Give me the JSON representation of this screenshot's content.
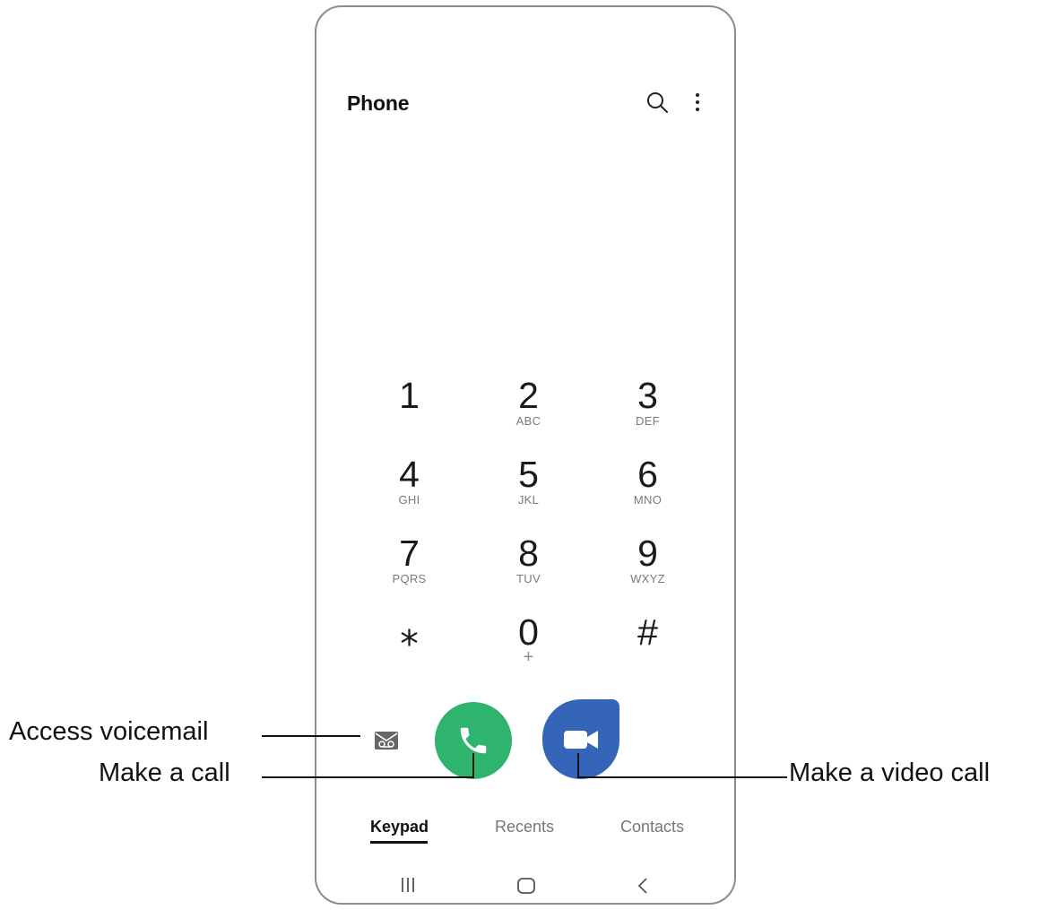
{
  "app": {
    "title": "Phone"
  },
  "keypad": {
    "keys": [
      {
        "digit": "1",
        "letters": ""
      },
      {
        "digit": "2",
        "letters": "ABC"
      },
      {
        "digit": "3",
        "letters": "DEF"
      },
      {
        "digit": "4",
        "letters": "GHI"
      },
      {
        "digit": "5",
        "letters": "JKL"
      },
      {
        "digit": "6",
        "letters": "MNO"
      },
      {
        "digit": "7",
        "letters": "PQRS"
      },
      {
        "digit": "8",
        "letters": "TUV"
      },
      {
        "digit": "9",
        "letters": "WXYZ"
      },
      {
        "digit": "⁎",
        "letters": ""
      },
      {
        "digit": "0",
        "letters": "+"
      },
      {
        "digit": "#",
        "letters": ""
      }
    ]
  },
  "tabs": {
    "keypad": "Keypad",
    "recents": "Recents",
    "contacts": "Contacts"
  },
  "icons": {
    "search": "search-icon",
    "more": "more-options-icon",
    "voicemail": "voicemail-icon",
    "call": "phone-icon",
    "video": "video-camera-icon",
    "nav_recent": "recent-apps-icon",
    "nav_home": "home-icon",
    "nav_back": "back-icon"
  },
  "callouts": {
    "voicemail": "Access voicemail",
    "call": "Make a call",
    "video": "Make a video call"
  },
  "colors": {
    "call_green": "#2eb46c",
    "video_blue": "#3465b8"
  }
}
